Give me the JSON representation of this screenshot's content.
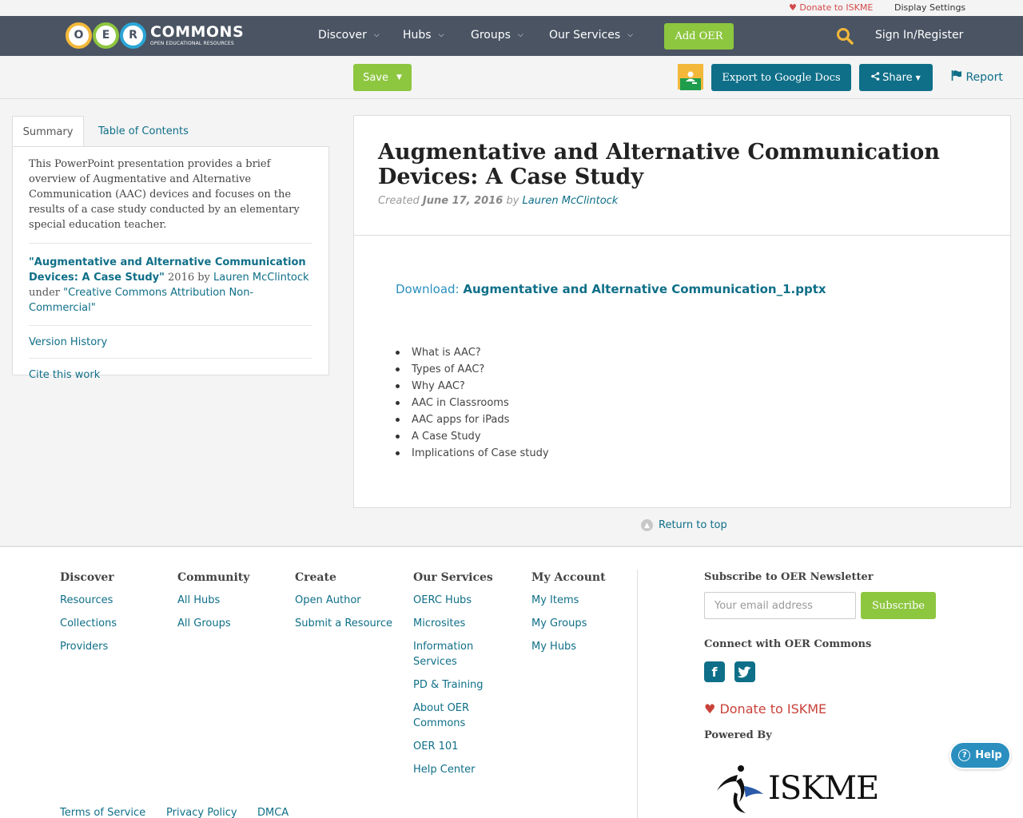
{
  "utility": {
    "donate": "Donate to ISKME",
    "display_settings": "Display Settings"
  },
  "logo": {
    "letters": [
      "O",
      "E",
      "R"
    ],
    "brand": "COMMONS",
    "tagline": "OPEN EDUCATIONAL RESOURCES"
  },
  "nav": {
    "items": [
      "Discover",
      "Hubs",
      "Groups",
      "Our Services"
    ],
    "add_oer": "Add OER",
    "sign_in": "Sign In/Register"
  },
  "toolbar": {
    "save": "Save",
    "export": "Export to Google Docs",
    "share": "Share",
    "report": "Report"
  },
  "sidebar": {
    "tabs": [
      "Summary",
      "Table of Contents"
    ],
    "summary": "This PowerPoint presentation provides a brief overview of Augmentative and Alternative Communication (AAC) devices and focuses on the results of a case study conducted by an elementary special education teacher.",
    "attribution": {
      "title": "\"Augmentative and Alternative Communication Devices: A Case Study\"",
      "year_by": " 2016 by ",
      "author": "Lauren McClintock",
      "under": "under ",
      "license": "\"Creative Commons Attribution Non-Commercial\""
    },
    "version_history": "Version History",
    "cite": "Cite this work"
  },
  "resource": {
    "title": "Augmentative and Alternative Communication Devices: A Case Study",
    "created_label": "Created ",
    "created_date": "June 17, 2016",
    "by_label": " by ",
    "author": "Lauren McClintock",
    "download_label": "Download: ",
    "download_file": "Augmentative and Alternative Communication_1.pptx",
    "outline": [
      "What is AAC?",
      "Types of AAC?",
      "Why AAC?",
      "AAC in Classrooms",
      "AAC apps for iPads",
      "A Case Study",
      "Implications of Case study"
    ]
  },
  "return_top": "Return to top",
  "footer": {
    "columns": [
      {
        "heading": "Discover",
        "links": [
          "Resources",
          "Collections",
          "Providers"
        ]
      },
      {
        "heading": "Community",
        "links": [
          "All Hubs",
          "All Groups"
        ]
      },
      {
        "heading": "Create",
        "links": [
          "Open Author",
          "Submit a Resource"
        ]
      },
      {
        "heading": "Our Services",
        "links": [
          "OERC Hubs",
          "Microsites",
          "Information Services",
          "PD & Training",
          "About OER Commons",
          "OER 101",
          "Help Center"
        ]
      },
      {
        "heading": "My Account",
        "links": [
          "My Items",
          "My Groups",
          "My Hubs"
        ]
      }
    ],
    "newsletter_heading": "Subscribe to OER Newsletter",
    "email_placeholder": "Your email address",
    "subscribe": "Subscribe",
    "connect_heading": "Connect with OER Commons",
    "donate": "Donate to ISKME",
    "powered_by": "Powered By",
    "iskme": "ISKME",
    "legal": [
      "Terms of Service",
      "Privacy Policy",
      "DMCA"
    ]
  },
  "help": "Help",
  "colors": {
    "navbar": "#4a5463",
    "accent_green": "#8dc63f",
    "accent_teal": "#0f6f88",
    "donate_red": "#c9423a"
  }
}
